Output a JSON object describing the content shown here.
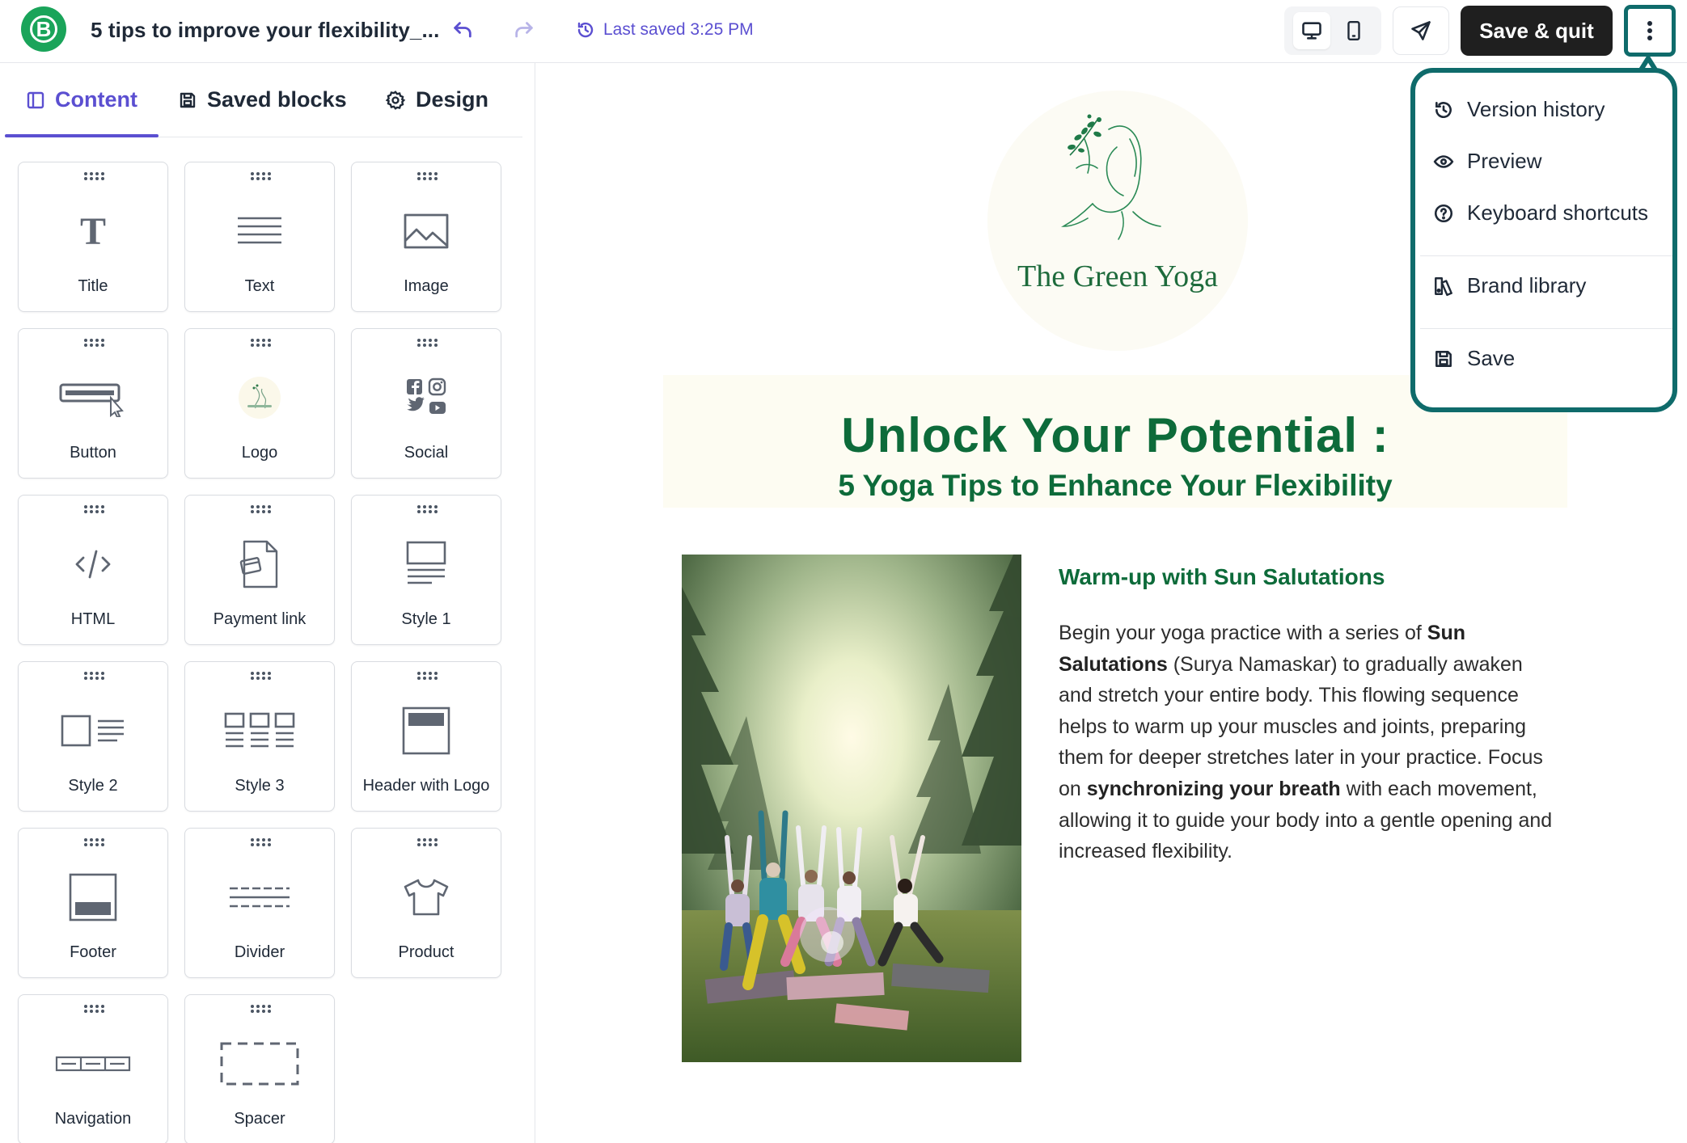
{
  "header": {
    "app_logo_letter": "B",
    "doc_title": "5 tips to improve your flexibility_...",
    "last_saved": "Last saved 3:25 PM",
    "save_quit_label": "Save & quit",
    "accent_color": "#5b4fd1",
    "brand_color": "#1aa45a"
  },
  "sidebar": {
    "tabs": [
      {
        "label": "Content",
        "icon": "layout-icon",
        "active": true
      },
      {
        "label": "Saved blocks",
        "icon": "save-icon",
        "active": false
      },
      {
        "label": "Design",
        "icon": "gear-icon",
        "active": false
      }
    ],
    "blocks": [
      {
        "label": "Title",
        "icon": "title-icon"
      },
      {
        "label": "Text",
        "icon": "text-icon"
      },
      {
        "label": "Image",
        "icon": "image-icon"
      },
      {
        "label": "Button",
        "icon": "button-icon"
      },
      {
        "label": "Logo",
        "icon": "logo-icon"
      },
      {
        "label": "Social",
        "icon": "social-icon"
      },
      {
        "label": "HTML",
        "icon": "code-icon"
      },
      {
        "label": "Payment link",
        "icon": "payment-link-icon"
      },
      {
        "label": "Style 1",
        "icon": "style-1-icon"
      },
      {
        "label": "Style 2",
        "icon": "style-2-icon"
      },
      {
        "label": "Style 3",
        "icon": "style-3-icon"
      },
      {
        "label": "Header with Logo",
        "icon": "header-with-logo-icon"
      },
      {
        "label": "Footer",
        "icon": "footer-icon"
      },
      {
        "label": "Divider",
        "icon": "divider-icon"
      },
      {
        "label": "Product",
        "icon": "tshirt-icon"
      },
      {
        "label": "Navigation",
        "icon": "navigation-icon"
      },
      {
        "label": "Spacer",
        "icon": "spacer-icon"
      }
    ]
  },
  "email": {
    "brand_name": "The Green Yoga",
    "hero_title": "Unlock Your Potential :",
    "hero_subtitle": "5 Yoga Tips to Enhance Your Flexibility",
    "section_heading": "Warm-up with Sun Salutations",
    "section_body": {
      "p1": "Begin your yoga practice with a series of ",
      "b1": "Sun Salutations",
      "p2": " (Surya Namaskar) to gradually awaken and stretch your entire body. This flowing sequence helps to warm up your muscles and joints, preparing them for deeper stretches later in your practice. Focus on ",
      "b2": "synchronizing your breath",
      "p3": " with each movement, allowing it to guide your body into a gentle opening and increased flexibility."
    },
    "text_color": "#0d6b3a"
  },
  "menu": {
    "items": [
      {
        "label": "Version history",
        "icon": "history-icon"
      },
      {
        "label": "Preview",
        "icon": "eye-icon"
      },
      {
        "label": "Keyboard shortcuts",
        "icon": "question-icon"
      },
      {
        "label": "Brand library",
        "icon": "brand-library-icon"
      },
      {
        "label": "Save",
        "icon": "save-icon"
      }
    ],
    "border_color": "#0f6b6b"
  }
}
